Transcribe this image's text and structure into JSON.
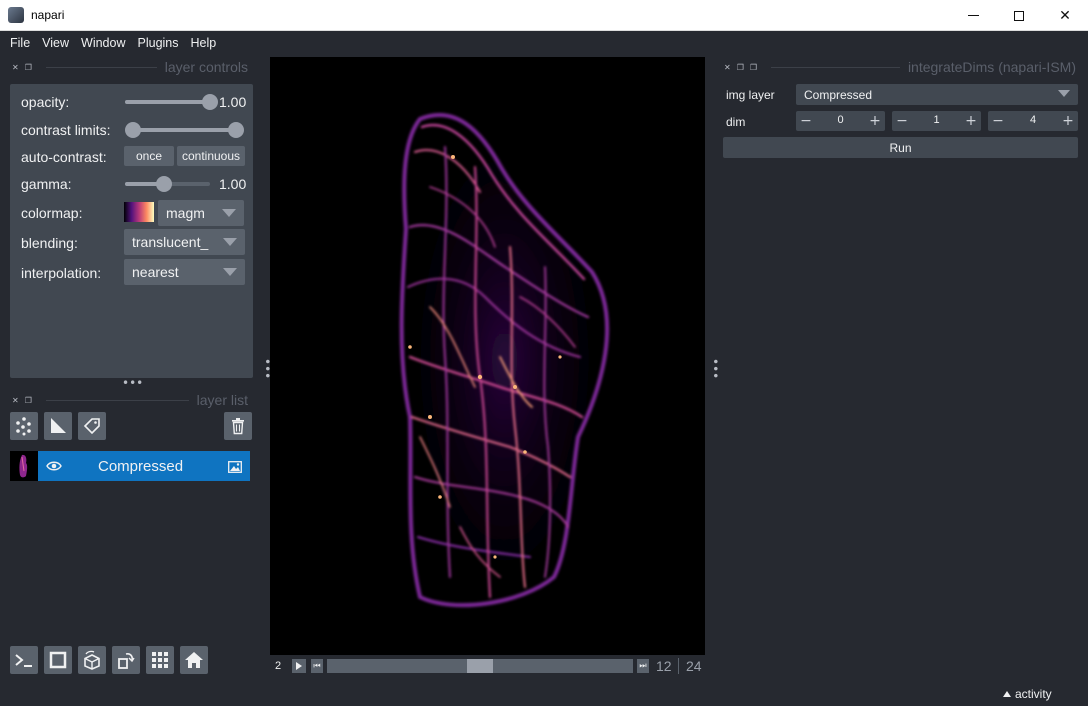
{
  "window": {
    "title": "napari"
  },
  "menu": [
    "File",
    "View",
    "Window",
    "Plugins",
    "Help"
  ],
  "layer_controls": {
    "header": "layer controls",
    "opacity": {
      "label": "opacity:",
      "value": "1.00",
      "level": 1.0
    },
    "contrast_limits": {
      "label": "contrast limits:",
      "low": 0.0,
      "high": 1.0
    },
    "auto_contrast": {
      "label": "auto-contrast:",
      "once": "once",
      "continuous": "continuous"
    },
    "gamma": {
      "label": "gamma:",
      "value": "1.00",
      "level": 0.46
    },
    "colormap": {
      "label": "colormap:",
      "value": "magm"
    },
    "blending": {
      "label": "blending:",
      "value": "translucent_"
    },
    "interpolation": {
      "label": "interpolation:",
      "value": "nearest"
    }
  },
  "layer_list": {
    "header": "layer list",
    "layers": [
      {
        "name": "Compressed",
        "visible": true
      }
    ]
  },
  "dims": {
    "axis": "2",
    "current": "12",
    "total": "24",
    "level": 0.5
  },
  "plugin": {
    "header": "integrateDims (napari-ISM)",
    "img_layer_label": "img layer",
    "img_layer_value": "Compressed",
    "dim_label": "dim",
    "dims": [
      "0",
      "1",
      "4"
    ],
    "run_label": "Run"
  },
  "status": {
    "activity": "activity"
  },
  "colors": {
    "accent": "#0f74c1",
    "background": "#262930",
    "panel": "#414851",
    "control": "#5a626c"
  }
}
